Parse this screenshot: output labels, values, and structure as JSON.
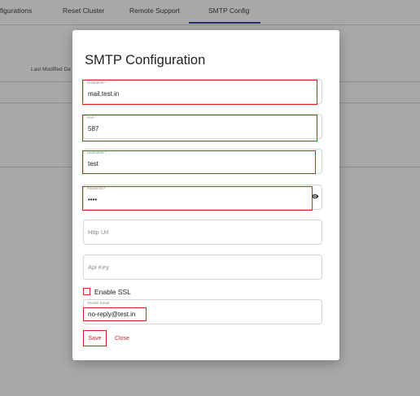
{
  "tabs": [
    {
      "label": "figurations"
    },
    {
      "label": "Reset Cluster"
    },
    {
      "label": "Remote Support"
    },
    {
      "label": "SMTP Config"
    }
  ],
  "background": {
    "last_modified_label": "Last Modified Da"
  },
  "dialog": {
    "title": "SMTP Configuration",
    "fields": {
      "hostname": {
        "label": "Hostname *",
        "value": "mail.test.in"
      },
      "port": {
        "label": "Port *",
        "value": "587"
      },
      "username": {
        "label": "Username *",
        "value": "test"
      },
      "password": {
        "label": "Password *",
        "value": "••••"
      },
      "http_url": {
        "placeholder": "Http Url"
      },
      "api_key": {
        "placeholder": "Api Key"
      },
      "sender_email": {
        "label": "Sender Email",
        "value": "no-reply@test.in"
      }
    },
    "enable_ssl_label": "Enable SSL",
    "save_label": "Save",
    "close_label": "Close"
  },
  "colors": {
    "highlight": "#e0201b",
    "action_text": "#c62828",
    "tab_indicator": "#3949ab"
  },
  "icons": {
    "password_toggle": "eye-icon"
  }
}
